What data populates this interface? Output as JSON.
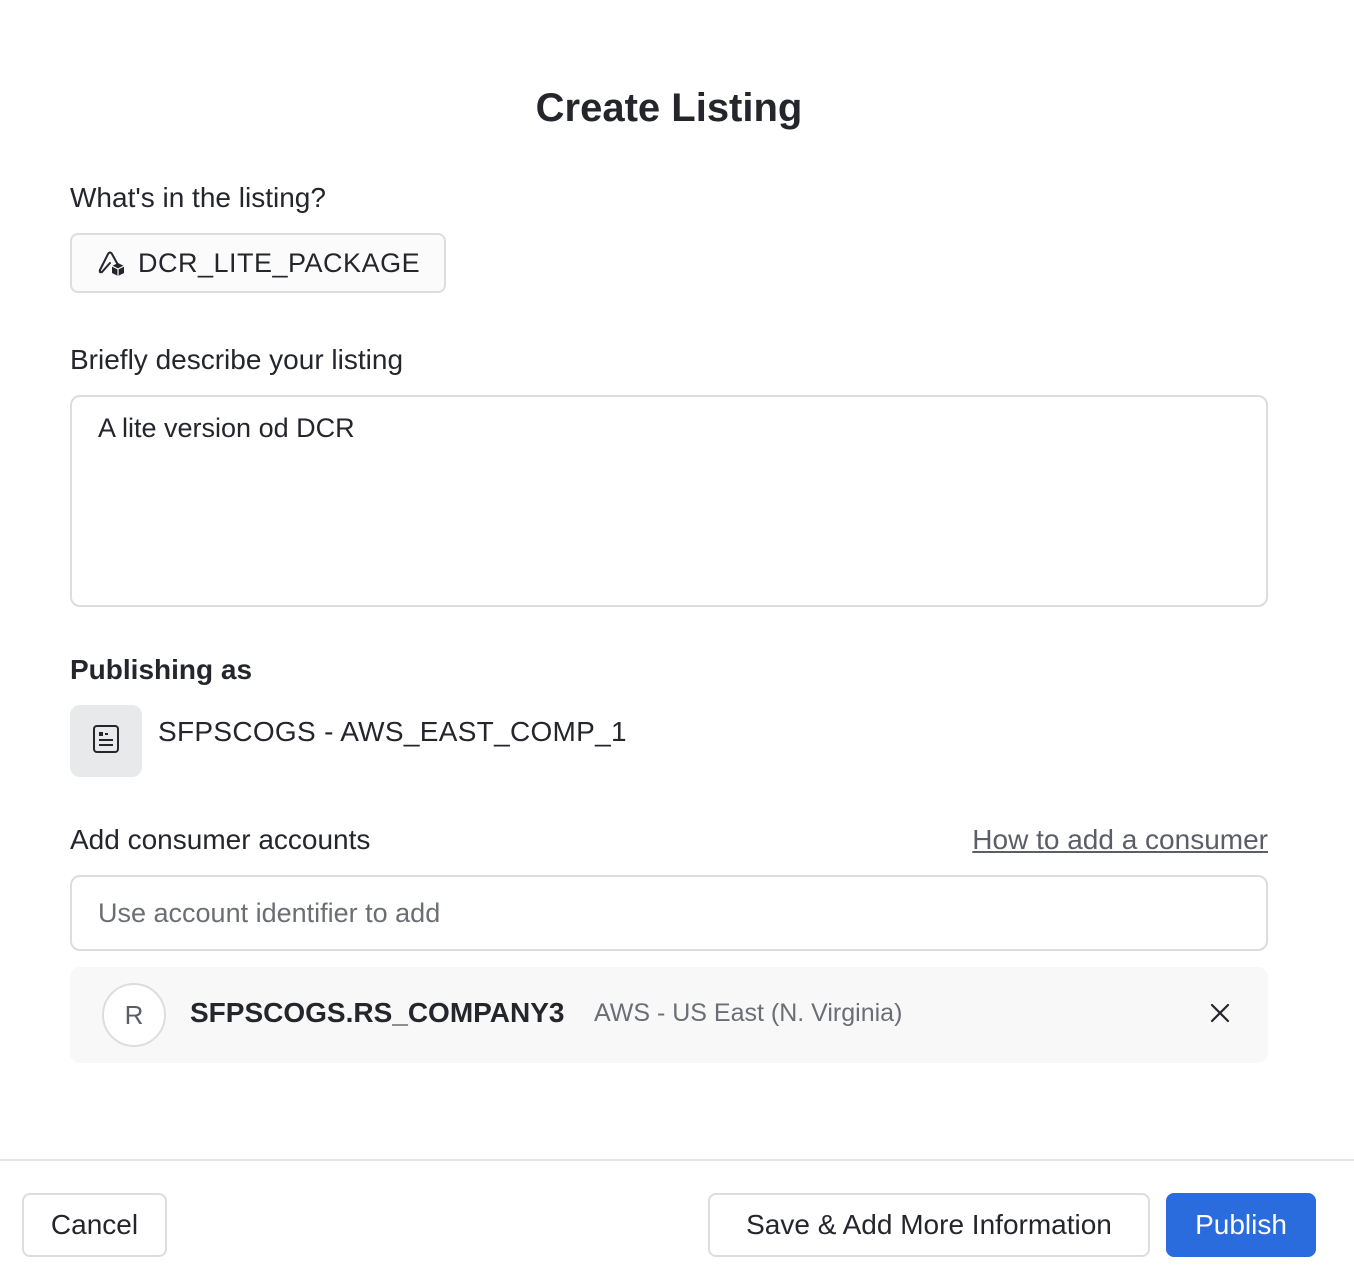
{
  "dialog": {
    "title": "Create Listing"
  },
  "listing_contents": {
    "label": "What's in the listing?",
    "package_icon": "package-icon",
    "package_name": "DCR_LITE_PACKAGE"
  },
  "description": {
    "label": "Briefly describe your listing",
    "value": "A lite version od DCR"
  },
  "publishing": {
    "label": "Publishing as",
    "account_icon": "account-icon",
    "account_name": "SFPSCOGS - AWS_EAST_COMP_1"
  },
  "consumers": {
    "label": "Add consumer accounts",
    "help_link": "How to add a consumer",
    "input_placeholder": "Use account identifier to add",
    "input_value": "",
    "items": [
      {
        "avatar_letter": "R",
        "identifier": "SFPSCOGS.RS_COMPANY3",
        "region": "AWS - US East (N. Virginia)",
        "remove_icon": "close-icon"
      }
    ]
  },
  "footer": {
    "cancel_label": "Cancel",
    "save_label": "Save & Add More Information",
    "publish_label": "Publish"
  },
  "colors": {
    "primary": "#2a6bde",
    "text": "#24262c",
    "muted_text": "#6b6e75",
    "border": "#dcdde0",
    "row_background": "#f8f8f9"
  }
}
